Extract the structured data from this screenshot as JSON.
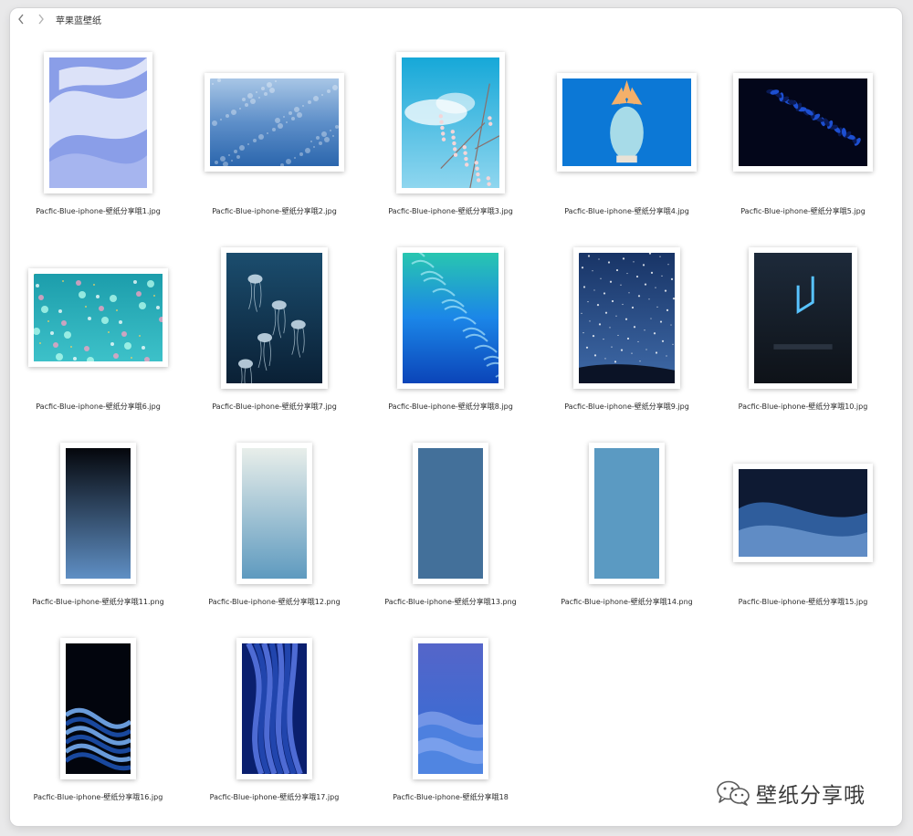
{
  "window": {
    "title": "苹果蓝壁纸",
    "back_icon": "chevron-left-icon",
    "forward_icon": "chevron-right-icon"
  },
  "files": [
    {
      "name": "Pacfic-Blue-iphone-壁纸分享哦1.jpg",
      "orientation": "portrait",
      "art": "ice",
      "colors": [
        "#8a9ee8",
        "#dfe6fb",
        "#a9b7f0"
      ]
    },
    {
      "name": "Pacfic-Blue-iphone-壁纸分享哦2.jpg",
      "orientation": "landscape",
      "art": "droplets",
      "colors": [
        "#2b66ad",
        "#5e8fc9",
        "#a8c6e6"
      ]
    },
    {
      "name": "Pacfic-Blue-iphone-壁纸分享哦3.jpg",
      "orientation": "portrait",
      "art": "sky",
      "colors": [
        "#16a8d8",
        "#8fd6ef",
        "#f4d5d8"
      ]
    },
    {
      "name": "Pacfic-Blue-iphone-壁纸分享哦4.jpg",
      "orientation": "landscape",
      "art": "pineapple",
      "colors": [
        "#0c78d6",
        "#f4b06a",
        "#a7dbe8"
      ]
    },
    {
      "name": "Pacfic-Blue-iphone-壁纸分享哦5.jpg",
      "orientation": "landscape",
      "art": "leaves",
      "colors": [
        "#03061a",
        "#1d4fd1",
        "#0a1a55"
      ]
    },
    {
      "name": "Pacfic-Blue-iphone-壁纸分享哦6.jpg",
      "orientation": "landscape",
      "art": "bokeh",
      "colors": [
        "#1c9dab",
        "#3dc1c9",
        "#ffc6d6"
      ]
    },
    {
      "name": "Pacfic-Blue-iphone-壁纸分享哦7.jpg",
      "orientation": "portrait",
      "art": "jellyfish",
      "colors": [
        "#0a2035",
        "#1b4d6e",
        "#cfe2ee"
      ]
    },
    {
      "name": "Pacfic-Blue-iphone-壁纸分享哦8.jpg",
      "orientation": "portrait",
      "art": "sea",
      "colors": [
        "#28c6b0",
        "#1b86e8",
        "#0b44b8"
      ]
    },
    {
      "name": "Pacfic-Blue-iphone-壁纸分享哦9.jpg",
      "orientation": "portrait",
      "art": "night",
      "colors": [
        "#183466",
        "#3f6aa8",
        "#0b1326"
      ]
    },
    {
      "name": "Pacfic-Blue-iphone-壁纸分享哦10.jpg",
      "orientation": "portrait",
      "art": "neon",
      "colors": [
        "#0e1218",
        "#1d2a3a",
        "#58c3ff"
      ]
    },
    {
      "name": "Pacfic-Blue-iphone-壁纸分享哦11.png",
      "orientation": "portrait",
      "art": "gradient",
      "colors": [
        "#05070c",
        "#5f8fc4"
      ]
    },
    {
      "name": "Pacfic-Blue-iphone-壁纸分享哦12.png",
      "orientation": "portrait",
      "art": "gradient",
      "colors": [
        "#e8eeea",
        "#5e9abf"
      ]
    },
    {
      "name": "Pacfic-Blue-iphone-壁纸分享哦13.png",
      "orientation": "portrait",
      "art": "solid",
      "colors": [
        "#43709a"
      ]
    },
    {
      "name": "Pacfic-Blue-iphone-壁纸分享哦14.png",
      "orientation": "portrait",
      "art": "solid",
      "colors": [
        "#5b9ac2"
      ]
    },
    {
      "name": "Pacfic-Blue-iphone-壁纸分享哦15.jpg",
      "orientation": "landscape",
      "art": "dunes",
      "colors": [
        "#0e1a33",
        "#2f5d9c",
        "#6d99d0"
      ]
    },
    {
      "name": "Pacfic-Blue-iphone-壁纸分享哦16.jpg",
      "orientation": "portrait",
      "art": "swirl",
      "colors": [
        "#02050d",
        "#1d55b8",
        "#7bb6ff"
      ]
    },
    {
      "name": "Pacfic-Blue-iphone-壁纸分享哦17.jpg",
      "orientation": "portrait",
      "art": "ribbons",
      "colors": [
        "#0a1f6e",
        "#2b55c8",
        "#6b8cff"
      ]
    },
    {
      "name": "Pacfic-Blue-iphone-壁纸分享哦18",
      "orientation": "portrait",
      "art": "waves",
      "colors": [
        "#5565c9",
        "#2f6fd8",
        "#9fb8f5"
      ]
    }
  ],
  "watermark": {
    "icon": "wechat-icon",
    "text": "壁纸分享哦"
  }
}
